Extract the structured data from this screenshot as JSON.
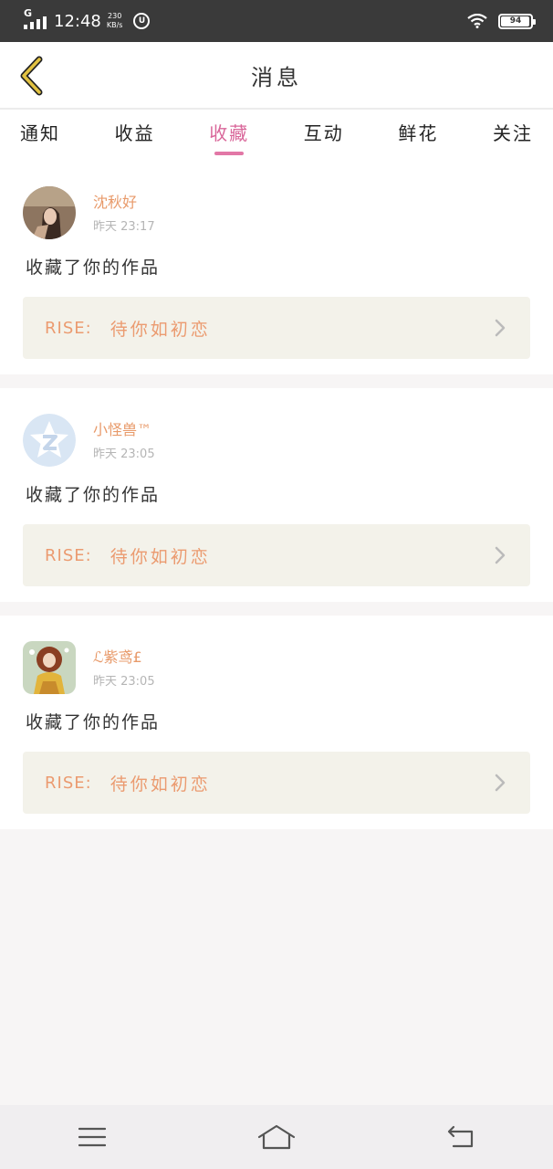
{
  "status_bar": {
    "network": "G",
    "time": "12:48",
    "speed_value": "230",
    "speed_unit": "KB/s",
    "badge": "U",
    "battery": "94"
  },
  "header": {
    "title": "消息"
  },
  "tabs": [
    {
      "label": "通知",
      "active": false
    },
    {
      "label": "收益",
      "active": false
    },
    {
      "label": "收藏",
      "active": true
    },
    {
      "label": "互动",
      "active": false
    },
    {
      "label": "鲜花",
      "active": false
    },
    {
      "label": "关注",
      "active": false
    }
  ],
  "messages": [
    {
      "username": "沈秋好",
      "time": "昨天 23:17",
      "action": "收藏了你的作品",
      "work_label": "RISE:",
      "work_title": "待你如初恋"
    },
    {
      "username": "小怪兽™",
      "time": "昨天 23:05",
      "action": "收藏了你的作品",
      "work_label": "RISE:",
      "work_title": "待你如初恋"
    },
    {
      "username": "ℒ紫鸢£",
      "time": "昨天 23:05",
      "action": "收藏了你的作品",
      "work_label": "RISE:",
      "work_title": "待你如初恋"
    }
  ],
  "colors": {
    "accent_pink": "#e277a6",
    "username_orange": "#e89a6a",
    "work_bg": "#f3f2ea",
    "back_icon": "#d8b830"
  },
  "icons": {
    "back": "chevron-left-icon",
    "work_arrow": "chevron-right-icon",
    "nav_menu": "menu-icon",
    "nav_home": "home-icon",
    "nav_back": "return-icon"
  }
}
